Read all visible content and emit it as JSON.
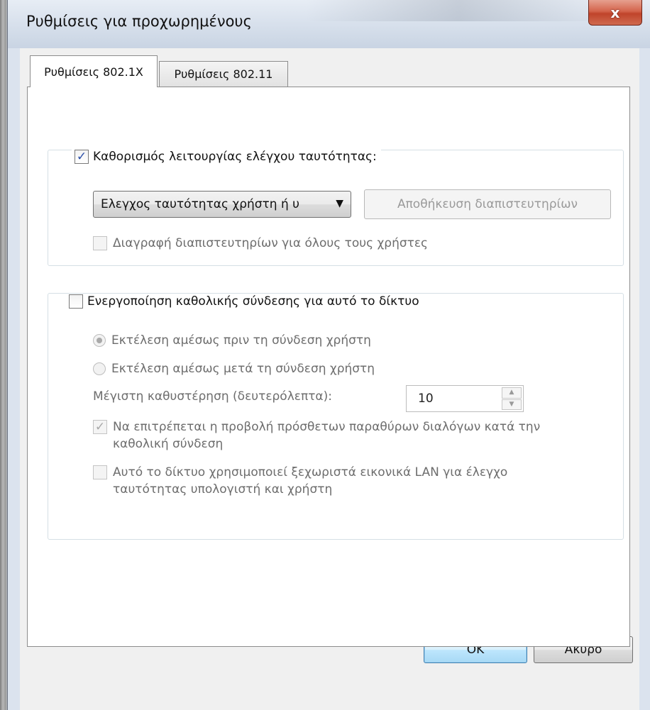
{
  "window": {
    "title": "Ρυθμίσεις για προχωρημένους",
    "close_symbol": "x"
  },
  "tabs": [
    {
      "label": "Ρυθμίσεις 802.1X",
      "active": true
    },
    {
      "label": "Ρυθμίσεις 802.11",
      "active": false
    }
  ],
  "auth_group": {
    "header_label": "Καθορισμός λειτουργίας ελέγχου ταυτότητας:",
    "header_checked": true,
    "mode_select_value": "Ελεγχος ταυτότητας χρήστη ή υ",
    "save_credentials_label": "Αποθήκευση διαπιστευτηρίων",
    "delete_credentials_label": "Διαγραφή διαπιστευτηρίων για όλους τους χρήστες",
    "delete_credentials_checked": false
  },
  "sso_group": {
    "header_label": "Ενεργοποίηση καθολικής σύνδεσης για αυτό το δίκτυο",
    "header_checked": false,
    "radio_before_label": "Εκτέλεση αμέσως πριν τη σύνδεση χρήστη",
    "radio_before_selected": true,
    "radio_after_label": "Εκτέλεση αμέσως μετά τη σύνδεση χρήστη",
    "radio_after_selected": false,
    "max_delay_label": "Μέγιστη καθυστέρηση (δευτερόλεπτα):",
    "max_delay_value": "10",
    "allow_dialogs_line1": "Να επιτρέπεται η προβολή πρόσθετων παραθύρων διαλόγων κατά την",
    "allow_dialogs_line2": "καθολική σύνδεση",
    "allow_dialogs_checked": true,
    "vlan_line1": "Αυτό το δίκτυο χρησιμοποιεί ξεχωριστά εικονικά LAN για έλεγχο",
    "vlan_line2": "ταυτότητας υπολογιστή και χρήστη",
    "vlan_checked": false
  },
  "footer": {
    "ok_label": "OK",
    "cancel_label": "Άκυρο"
  },
  "icons": {
    "check_glyph": "✓",
    "dropdown_glyph": "▼",
    "spin_up_glyph": "▲",
    "spin_down_glyph": "▼"
  },
  "colors": {
    "window_frame": "#dbe3ee",
    "close_button": "#c0442b",
    "ok_button_border": "#3c7fb1",
    "checkmark": "#2b4fa8",
    "disabled_text": "#6d6d6d"
  }
}
